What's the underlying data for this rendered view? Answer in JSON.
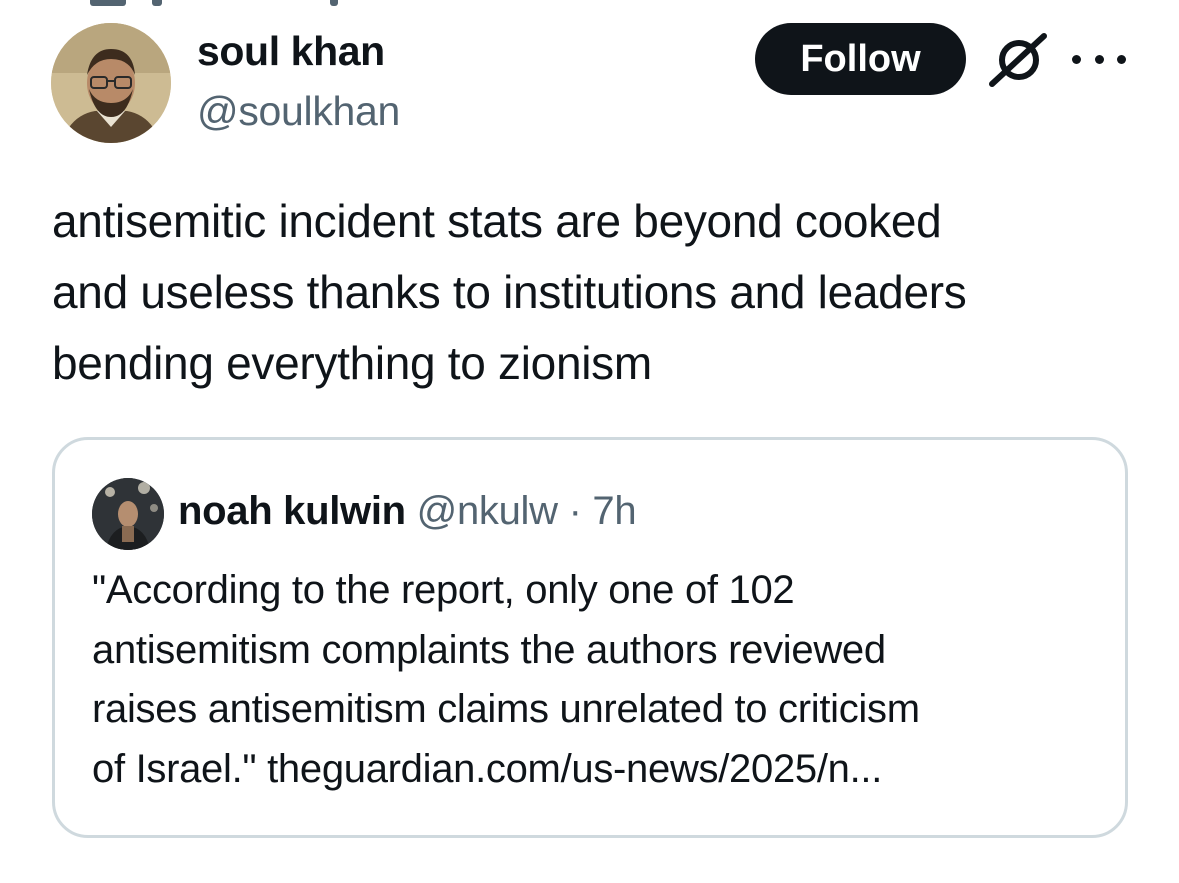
{
  "post": {
    "author": {
      "display_name": "soul khan",
      "handle": "@soulkhan"
    },
    "follow_label": "Follow",
    "text_lines": [
      "antisemitic incident stats are beyond cooked",
      "and useless thanks to institutions and leaders",
      "bending everything to zionism"
    ]
  },
  "quote": {
    "author": {
      "display_name": "noah kulwin",
      "handle": "@nkulw",
      "separator": "·",
      "time": "7h"
    },
    "text_lines": [
      "\"According to the report, only one of 102",
      "antisemitism complaints the authors reviewed",
      "raises antisemitism claims unrelated to criticism",
      "of Israel.\" theguardian.com/us-news/2025/n..."
    ]
  },
  "icons": {
    "grok": "grok-icon",
    "more": "more-options-icon"
  },
  "colors": {
    "text": "#0f1419",
    "secondary_text": "#536471",
    "follow_button_bg": "#0f1419",
    "card_border": "#cfd9de"
  }
}
